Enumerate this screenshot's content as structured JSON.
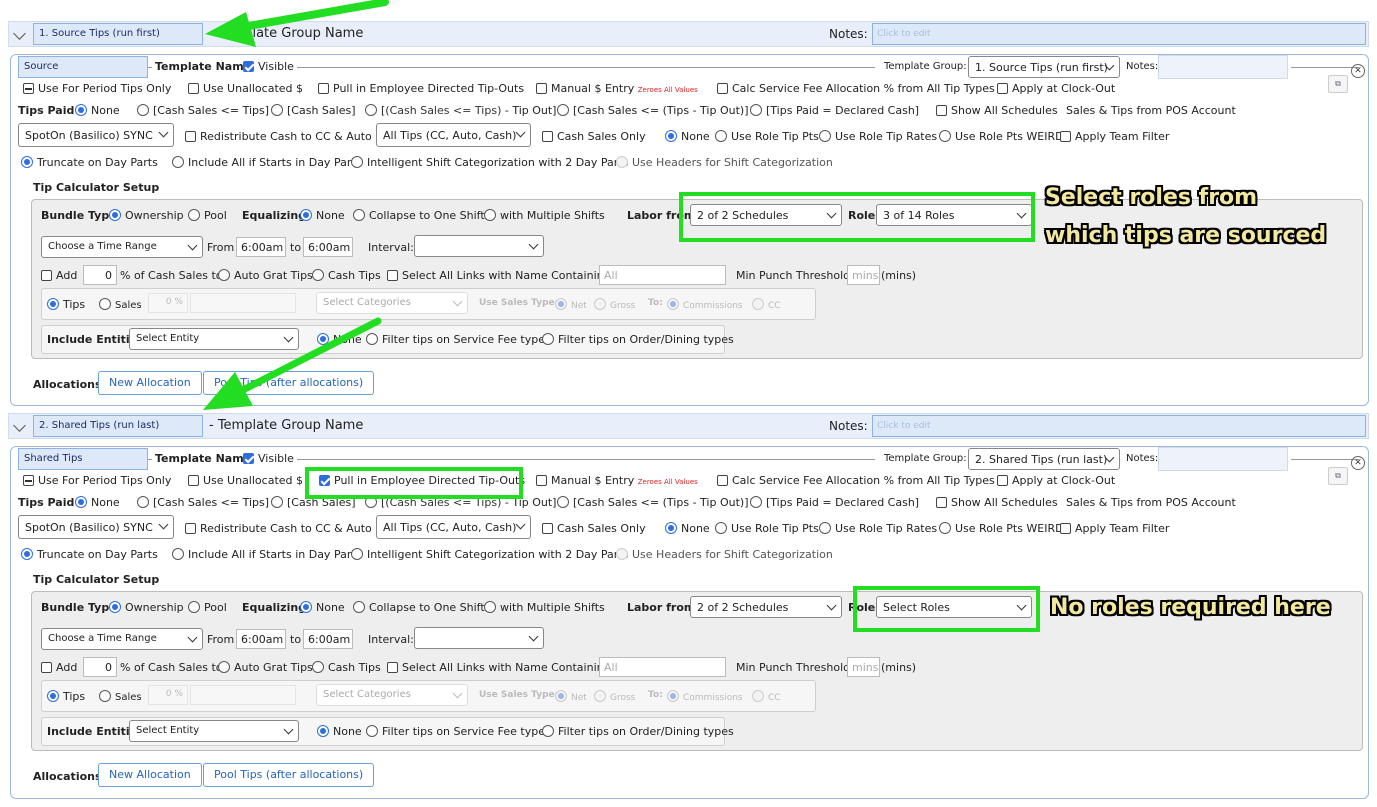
{
  "groups": [
    {
      "header": {
        "name_value": "1. Source Tips (run first)",
        "title": "- Template Group Name",
        "notes_label": "Notes:",
        "notes_placeholder": "Click to edit"
      },
      "template": {
        "name_value": "Source",
        "name_label": "Template Name",
        "visible_label": "Visible",
        "group_label": "Template Group:",
        "group_value": "1. Source Tips (run first)",
        "notes_label": "Notes:",
        "row1": {
          "period": "Use For Period Tips Only",
          "unallocated": "Use Unallocated $",
          "pull_in": "Pull in Employee Directed Tip-Outs",
          "manual": "Manual $ Entry",
          "zeroes": "Zeroes All Values",
          "calc_fee": "Calc Service Fee Allocation % from All Tip Types",
          "clock_out": "Apply at Clock-Out"
        },
        "tips_paid": {
          "label": "Tips Paid",
          "opt_none": "None",
          "opt_a": "[Cash Sales <= Tips]",
          "opt_b": "[Cash Sales]",
          "opt_c1": "[",
          "opt_c2": "(Cash Sales <= Tips)",
          "opt_c3": " - Tip Out]",
          "opt_d1": "[Cash Sales <= ",
          "opt_d2": "(Tips - Tip Out)",
          "opt_d3": "]",
          "opt_e": "[Tips Paid = Declared Cash]",
          "show_all": "Show All Schedules",
          "sales_tips": "Sales & Tips from POS Account"
        },
        "row3": {
          "pos": "SpotOn (Basilico) SYNC",
          "redistribute": "Redistribute Cash to CC & Auto",
          "tip_types": "All Tips (CC, Auto, Cash)",
          "cash_only": "Cash Sales Only",
          "none": "None",
          "role_pts": "Use Role Tip Pts",
          "role_rates": "Use Role Tip Rates",
          "role_weird": "Use Role Pts WEIRD",
          "team_filter": "Apply Team Filter"
        },
        "row4": {
          "truncate": "Truncate on Day Parts",
          "include_all": "Include All if Starts in Day Part",
          "intelligent": "Intelligent Shift Categorization with 2 Day Parts",
          "headers": "Use Headers for Shift Categorization"
        },
        "setup_label": "Tip Calculator Setup",
        "calc": {
          "bundle_label": "Bundle Type",
          "ownership": "Ownership",
          "pool": "Pool",
          "equalizing_label": "Equalizing",
          "eq_none": "None",
          "collapse": "Collapse to One Shift",
          "multiple": "with Multiple Shifts",
          "labor_label": "Labor from",
          "labor_value": "2 of 2 Schedules",
          "roles_label": "Roles",
          "roles_value": "3 of 14 Roles",
          "time_range": "Choose a Time Range",
          "from_label": "From",
          "from_value": "6:00am",
          "to_label": "to",
          "to_value": "6:00am",
          "interval_label": "Interval:",
          "add_label": "Add",
          "add_value": "0",
          "pct_label": "% of Cash Sales to",
          "auto_grat": "Auto Grat Tips",
          "cash_tips": "Cash Tips",
          "select_links": "Select All Links with Name Containing",
          "links_placeholder": "All",
          "min_punch": "Min Punch Threshold",
          "mins_placeholder": "mins",
          "mins_unit": "(mins)",
          "tips": "Tips",
          "sales": "Sales",
          "pct_value": "0 %",
          "categories": "Select Categories",
          "sales_type": "Use Sales Type:",
          "net": "Net",
          "gross": "Gross",
          "to": "To:",
          "commissions": "Commissions",
          "cc": "CC",
          "include_label": "Include Entities",
          "entity": "Select Entity",
          "f_none": "None",
          "f_service": "Filter tips on Service Fee types",
          "f_order": "Filter tips on Order/Dining types"
        },
        "alloc_label": "Allocations",
        "new_alloc": "New Allocation",
        "pool_tips": "Pool Tips (after allocations)"
      }
    },
    {
      "header": {
        "name_value": "2. Shared Tips (run last)",
        "title": "- Template Group Name",
        "notes_label": "Notes:",
        "notes_placeholder": "Click to edit"
      },
      "template": {
        "name_value": "Shared Tips",
        "name_label": "Template Name",
        "visible_label": "Visible",
        "group_label": "Template Group:",
        "group_value": "2. Shared Tips (run last)",
        "notes_label": "Notes:",
        "row1": {
          "period": "Use For Period Tips Only",
          "unallocated": "Use Unallocated $",
          "pull_in": "Pull in Employee Directed Tip-Outs",
          "manual": "Manual $ Entry",
          "zeroes": "Zeroes All Values",
          "calc_fee": "Calc Service Fee Allocation % from All Tip Types",
          "clock_out": "Apply at Clock-Out"
        },
        "tips_paid": {
          "label": "Tips Paid",
          "opt_none": "None",
          "opt_a": "[Cash Sales <= Tips]",
          "opt_b": "[Cash Sales]",
          "opt_c1": "[",
          "opt_c2": "(Cash Sales <= Tips)",
          "opt_c3": " - Tip Out]",
          "opt_d1": "[Cash Sales <= ",
          "opt_d2": "(Tips - Tip Out)",
          "opt_d3": "]",
          "opt_e": "[Tips Paid = Declared Cash]",
          "show_all": "Show All Schedules",
          "sales_tips": "Sales & Tips from POS Account"
        },
        "row3": {
          "pos": "SpotOn (Basilico) SYNC",
          "redistribute": "Redistribute Cash to CC & Auto",
          "tip_types": "All Tips (CC, Auto, Cash)",
          "cash_only": "Cash Sales Only",
          "none": "None",
          "role_pts": "Use Role Tip Pts",
          "role_rates": "Use Role Tip Rates",
          "role_weird": "Use Role Pts WEIRD",
          "team_filter": "Apply Team Filter"
        },
        "row4": {
          "truncate": "Truncate on Day Parts",
          "include_all": "Include All if Starts in Day Part",
          "intelligent": "Intelligent Shift Categorization with 2 Day Parts",
          "headers": "Use Headers for Shift Categorization"
        },
        "setup_label": "Tip Calculator Setup",
        "calc": {
          "bundle_label": "Bundle Type",
          "ownership": "Ownership",
          "pool": "Pool",
          "equalizing_label": "Equalizing",
          "eq_none": "None",
          "collapse": "Collapse to One Shift",
          "multiple": "with Multiple Shifts",
          "labor_label": "Labor from",
          "labor_value": "2 of 2 Schedules",
          "roles_label": "Roles",
          "roles_value": "Select Roles",
          "time_range": "Choose a Time Range",
          "from_label": "From",
          "from_value": "6:00am",
          "to_label": "to",
          "to_value": "6:00am",
          "interval_label": "Interval:",
          "add_label": "Add",
          "add_value": "0",
          "pct_label": "% of Cash Sales to",
          "auto_grat": "Auto Grat Tips",
          "cash_tips": "Cash Tips",
          "select_links": "Select All Links with Name Containing",
          "links_placeholder": "All",
          "min_punch": "Min Punch Threshold",
          "mins_placeholder": "mins",
          "mins_unit": "(mins)",
          "tips": "Tips",
          "sales": "Sales",
          "pct_value": "0 %",
          "categories": "Select Categories",
          "sales_type": "Use Sales Type:",
          "net": "Net",
          "gross": "Gross",
          "to": "To:",
          "commissions": "Commissions",
          "cc": "CC",
          "include_label": "Include Entities",
          "entity": "Select Entity",
          "f_none": "None",
          "f_service": "Filter tips on Service Fee types",
          "f_order": "Filter tips on Order/Dining types"
        },
        "alloc_label": "Allocations",
        "new_alloc": "New Allocation",
        "pool_tips": "Pool Tips (after allocations)"
      }
    }
  ],
  "annotations": {
    "source_line1": "Select roles from",
    "source_line2": "which tips are sourced",
    "shared_line": "No roles required here",
    "highlight_color": "#22dd22",
    "arrow_color": "#22dd22"
  },
  "colors": {
    "accent": "#2d6ddd",
    "header_bg": "#e8eefa",
    "input_bg": "#dde9f8",
    "calc_bg": "#eeeeee",
    "zeroes_red": "#e02020"
  }
}
